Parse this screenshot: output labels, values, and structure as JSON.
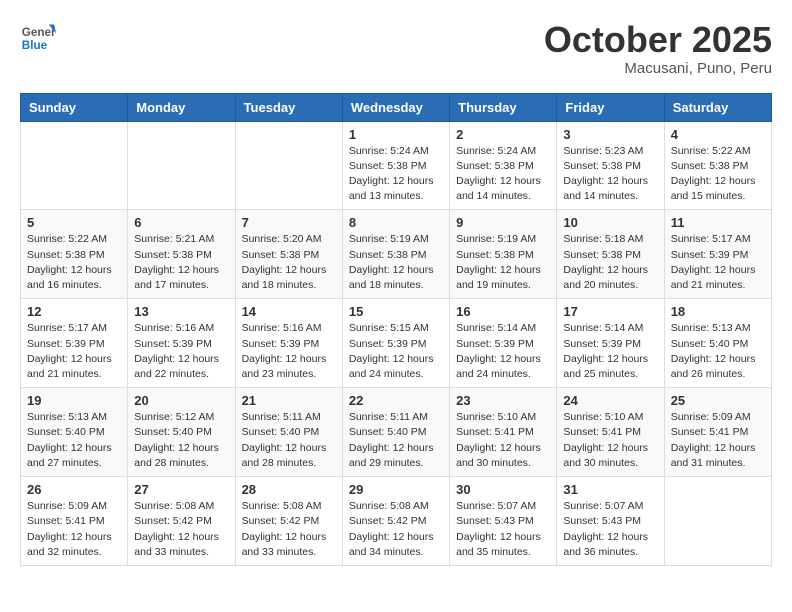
{
  "header": {
    "logo_general": "General",
    "logo_blue": "Blue",
    "month": "October 2025",
    "location": "Macusani, Puno, Peru"
  },
  "days_of_week": [
    "Sunday",
    "Monday",
    "Tuesday",
    "Wednesday",
    "Thursday",
    "Friday",
    "Saturday"
  ],
  "weeks": [
    [
      {
        "day": "",
        "info": ""
      },
      {
        "day": "",
        "info": ""
      },
      {
        "day": "",
        "info": ""
      },
      {
        "day": "1",
        "info": "Sunrise: 5:24 AM\nSunset: 5:38 PM\nDaylight: 12 hours\nand 13 minutes."
      },
      {
        "day": "2",
        "info": "Sunrise: 5:24 AM\nSunset: 5:38 PM\nDaylight: 12 hours\nand 14 minutes."
      },
      {
        "day": "3",
        "info": "Sunrise: 5:23 AM\nSunset: 5:38 PM\nDaylight: 12 hours\nand 14 minutes."
      },
      {
        "day": "4",
        "info": "Sunrise: 5:22 AM\nSunset: 5:38 PM\nDaylight: 12 hours\nand 15 minutes."
      }
    ],
    [
      {
        "day": "5",
        "info": "Sunrise: 5:22 AM\nSunset: 5:38 PM\nDaylight: 12 hours\nand 16 minutes."
      },
      {
        "day": "6",
        "info": "Sunrise: 5:21 AM\nSunset: 5:38 PM\nDaylight: 12 hours\nand 17 minutes."
      },
      {
        "day": "7",
        "info": "Sunrise: 5:20 AM\nSunset: 5:38 PM\nDaylight: 12 hours\nand 18 minutes."
      },
      {
        "day": "8",
        "info": "Sunrise: 5:19 AM\nSunset: 5:38 PM\nDaylight: 12 hours\nand 18 minutes."
      },
      {
        "day": "9",
        "info": "Sunrise: 5:19 AM\nSunset: 5:38 PM\nDaylight: 12 hours\nand 19 minutes."
      },
      {
        "day": "10",
        "info": "Sunrise: 5:18 AM\nSunset: 5:38 PM\nDaylight: 12 hours\nand 20 minutes."
      },
      {
        "day": "11",
        "info": "Sunrise: 5:17 AM\nSunset: 5:39 PM\nDaylight: 12 hours\nand 21 minutes."
      }
    ],
    [
      {
        "day": "12",
        "info": "Sunrise: 5:17 AM\nSunset: 5:39 PM\nDaylight: 12 hours\nand 21 minutes."
      },
      {
        "day": "13",
        "info": "Sunrise: 5:16 AM\nSunset: 5:39 PM\nDaylight: 12 hours\nand 22 minutes."
      },
      {
        "day": "14",
        "info": "Sunrise: 5:16 AM\nSunset: 5:39 PM\nDaylight: 12 hours\nand 23 minutes."
      },
      {
        "day": "15",
        "info": "Sunrise: 5:15 AM\nSunset: 5:39 PM\nDaylight: 12 hours\nand 24 minutes."
      },
      {
        "day": "16",
        "info": "Sunrise: 5:14 AM\nSunset: 5:39 PM\nDaylight: 12 hours\nand 24 minutes."
      },
      {
        "day": "17",
        "info": "Sunrise: 5:14 AM\nSunset: 5:39 PM\nDaylight: 12 hours\nand 25 minutes."
      },
      {
        "day": "18",
        "info": "Sunrise: 5:13 AM\nSunset: 5:40 PM\nDaylight: 12 hours\nand 26 minutes."
      }
    ],
    [
      {
        "day": "19",
        "info": "Sunrise: 5:13 AM\nSunset: 5:40 PM\nDaylight: 12 hours\nand 27 minutes."
      },
      {
        "day": "20",
        "info": "Sunrise: 5:12 AM\nSunset: 5:40 PM\nDaylight: 12 hours\nand 28 minutes."
      },
      {
        "day": "21",
        "info": "Sunrise: 5:11 AM\nSunset: 5:40 PM\nDaylight: 12 hours\nand 28 minutes."
      },
      {
        "day": "22",
        "info": "Sunrise: 5:11 AM\nSunset: 5:40 PM\nDaylight: 12 hours\nand 29 minutes."
      },
      {
        "day": "23",
        "info": "Sunrise: 5:10 AM\nSunset: 5:41 PM\nDaylight: 12 hours\nand 30 minutes."
      },
      {
        "day": "24",
        "info": "Sunrise: 5:10 AM\nSunset: 5:41 PM\nDaylight: 12 hours\nand 30 minutes."
      },
      {
        "day": "25",
        "info": "Sunrise: 5:09 AM\nSunset: 5:41 PM\nDaylight: 12 hours\nand 31 minutes."
      }
    ],
    [
      {
        "day": "26",
        "info": "Sunrise: 5:09 AM\nSunset: 5:41 PM\nDaylight: 12 hours\nand 32 minutes."
      },
      {
        "day": "27",
        "info": "Sunrise: 5:08 AM\nSunset: 5:42 PM\nDaylight: 12 hours\nand 33 minutes."
      },
      {
        "day": "28",
        "info": "Sunrise: 5:08 AM\nSunset: 5:42 PM\nDaylight: 12 hours\nand 33 minutes."
      },
      {
        "day": "29",
        "info": "Sunrise: 5:08 AM\nSunset: 5:42 PM\nDaylight: 12 hours\nand 34 minutes."
      },
      {
        "day": "30",
        "info": "Sunrise: 5:07 AM\nSunset: 5:43 PM\nDaylight: 12 hours\nand 35 minutes."
      },
      {
        "day": "31",
        "info": "Sunrise: 5:07 AM\nSunset: 5:43 PM\nDaylight: 12 hours\nand 36 minutes."
      },
      {
        "day": "",
        "info": ""
      }
    ]
  ]
}
